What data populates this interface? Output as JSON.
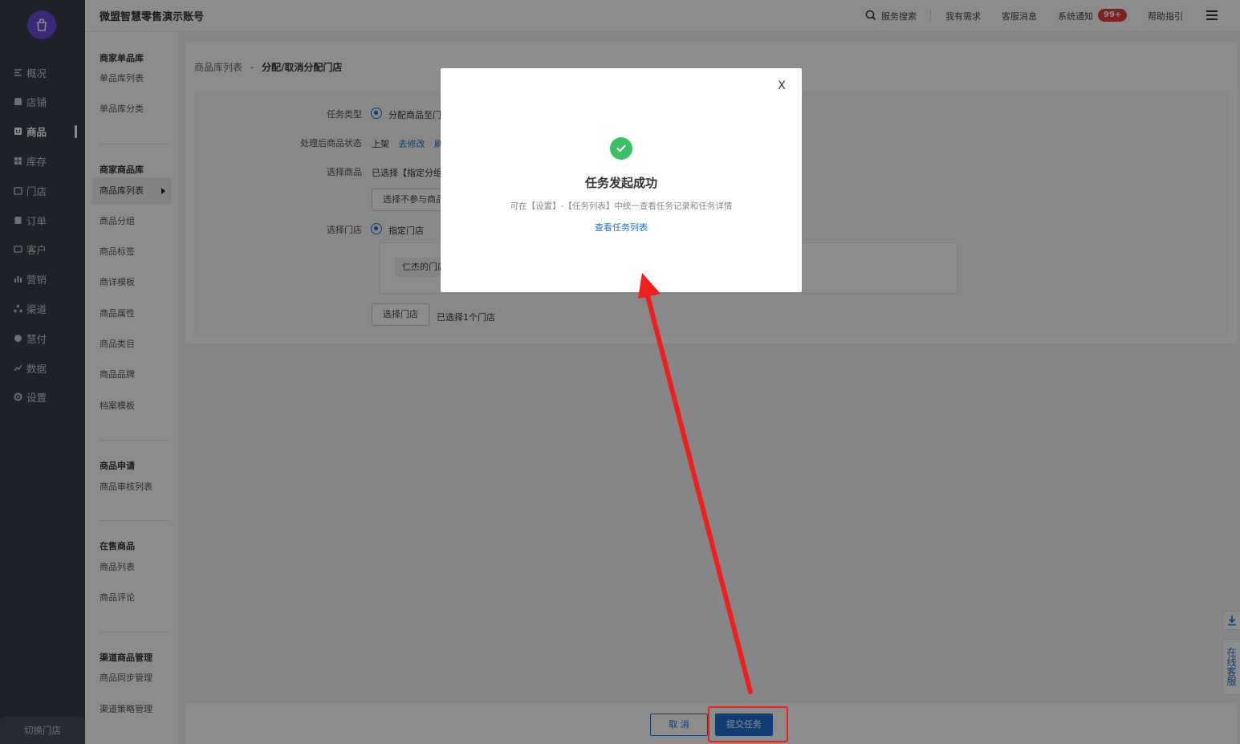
{
  "app": {
    "account_title": "微盟智慧零售演示账号",
    "switch_store": "切换门店"
  },
  "nav": {
    "items": [
      {
        "label": "概况",
        "icon": "overview-icon"
      },
      {
        "label": "店铺",
        "icon": "shop-icon"
      },
      {
        "label": "商品",
        "icon": "goods-icon",
        "active": true
      },
      {
        "label": "库存",
        "icon": "inventory-icon"
      },
      {
        "label": "门店",
        "icon": "store-icon"
      },
      {
        "label": "订单",
        "icon": "order-icon"
      },
      {
        "label": "客户",
        "icon": "customer-icon"
      },
      {
        "label": "营销",
        "icon": "marketing-icon"
      },
      {
        "label": "渠道",
        "icon": "channel-icon"
      },
      {
        "label": "慧付",
        "icon": "pay-icon"
      },
      {
        "label": "数据",
        "icon": "data-icon"
      },
      {
        "label": "设置",
        "icon": "settings-icon"
      }
    ]
  },
  "subnav": {
    "groups": [
      {
        "title": "商家单品库",
        "items": [
          "单品库列表",
          "单品库分类"
        ]
      },
      {
        "title": "商家商品库",
        "items": [
          "商品库列表",
          "商品分组",
          "商品标签",
          "商详模板",
          "商品属性",
          "商品类目",
          "商品品牌",
          "档案模板"
        ]
      },
      {
        "title": "商品申请",
        "items": [
          "商品审核列表"
        ]
      },
      {
        "title": "在售商品",
        "items": [
          "商品列表",
          "商品评论"
        ]
      },
      {
        "title": "渠道商品管理",
        "items": [
          "商品同步管理",
          "渠道策略管理"
        ]
      }
    ]
  },
  "topbar": {
    "search": "服务搜索",
    "needs": "我有需求",
    "service_msg": "客服消息",
    "notice": "系统通知",
    "notice_badge": "99+",
    "help": "帮助指引"
  },
  "breadcrumb": {
    "parent": "商品库列表",
    "sep": "-",
    "current": "分配/取消分配门店"
  },
  "form": {
    "task_type_label": "任务类型",
    "task_type_value": "分配商品至门",
    "status_label": "处理后商品状态",
    "status_value": "上架",
    "status_edit": "去修改",
    "status_refresh": "刷",
    "goods_label": "选择商品",
    "goods_value": "已选择【指定分组",
    "exclude_button": "选择不参与商品",
    "store_label": "选择门店",
    "store_option": "指定门店",
    "store_chip": "仁杰的门店",
    "select_store_button": "选择门店",
    "selected_count": "已选择1个门店"
  },
  "footer": {
    "cancel": "取 消",
    "submit": "提交任务"
  },
  "float": {
    "cs_chars": [
      "在",
      "线",
      "客",
      "服"
    ]
  },
  "modal": {
    "close": "X",
    "title": "任务发起成功",
    "desc": "可在【设置】-【任务列表】中统一查看任务记录和任务详情",
    "link": "查看任务列表"
  },
  "colors": {
    "primary": "#1f6fd1",
    "success": "#3cc063",
    "annotation": "#f01f1f",
    "nav_bg": "#3a3d4a",
    "logo": "#6b4bd8"
  }
}
